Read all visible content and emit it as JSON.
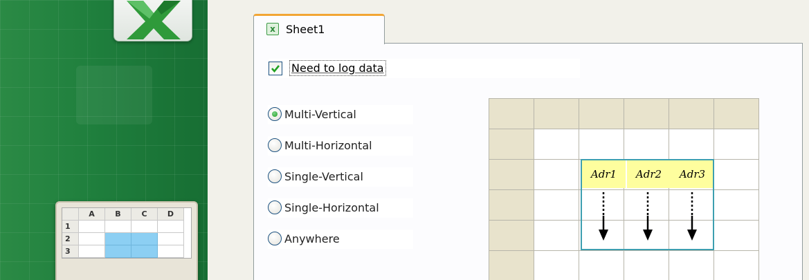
{
  "tab": {
    "label": "Sheet1",
    "icon": "excel-sheet-icon"
  },
  "log_checkbox": {
    "label": "Need to log data",
    "checked": true
  },
  "layout_options": [
    {
      "label": "Multi-Vertical",
      "selected": true
    },
    {
      "label": "Multi-Horizontal",
      "selected": false
    },
    {
      "label": "Single-Vertical",
      "selected": false
    },
    {
      "label": "Single-Horizontal",
      "selected": false
    },
    {
      "label": "Anywhere",
      "selected": false
    }
  ],
  "mini_sheet": {
    "columns": [
      "A",
      "B",
      "C",
      "D"
    ],
    "rows": [
      "1",
      "2",
      "3"
    ]
  },
  "illustration": {
    "headers": [
      "Adr1",
      "Adr2",
      "Adr3"
    ]
  },
  "colors": {
    "banner_green": "#1f7f3d",
    "tab_accent": "#f2a534",
    "address_fill": "#fefe9e",
    "selection_border": "#3d9fb0",
    "radio_selected": "#21a121"
  }
}
